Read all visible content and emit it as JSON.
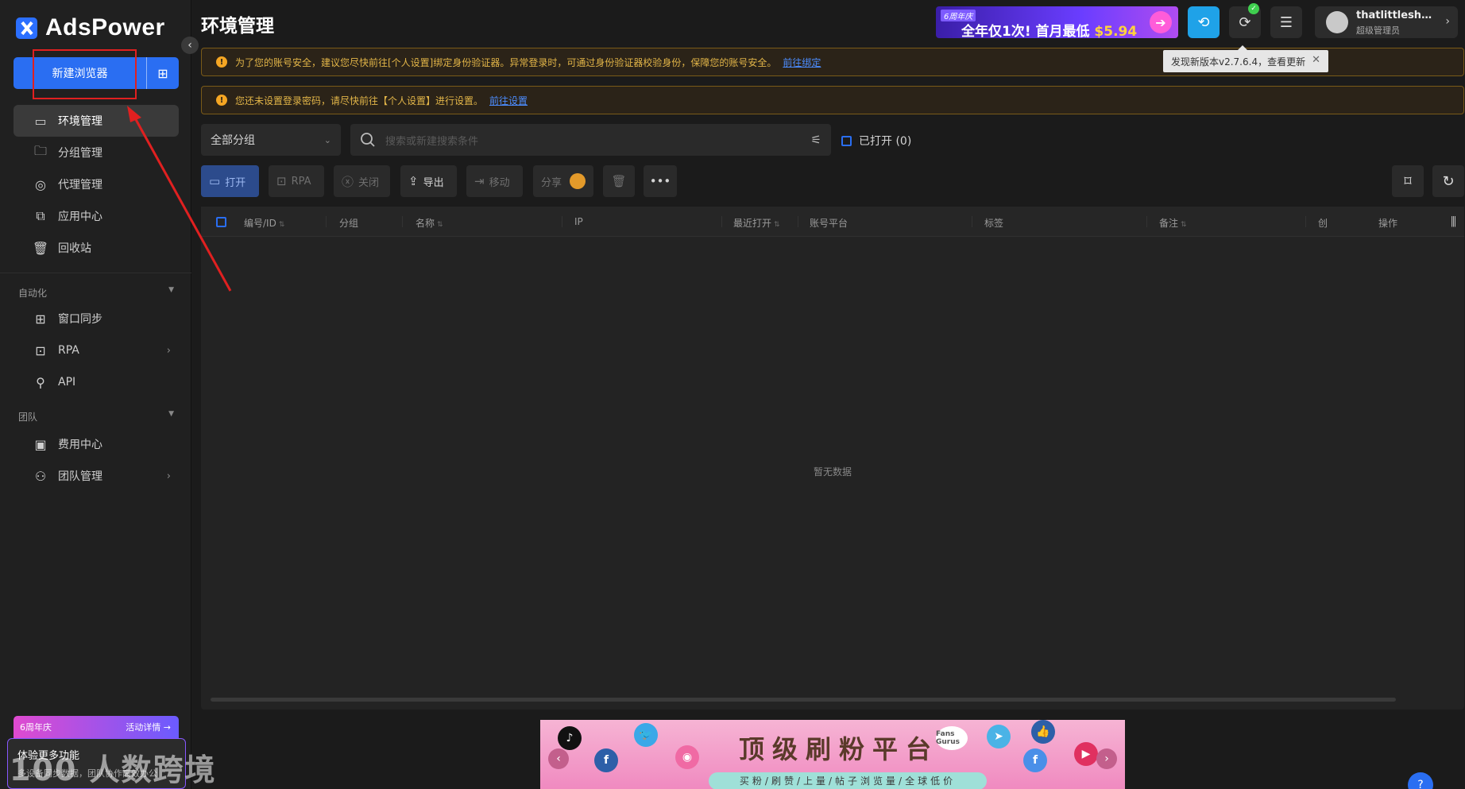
{
  "app": {
    "name": "AdsPower"
  },
  "sidebar": {
    "new_browser_label": "新建浏览器",
    "items": [
      {
        "label": "环境管理",
        "icon": "browser-window-icon",
        "glyph": "▭"
      },
      {
        "label": "分组管理",
        "icon": "folder-icon",
        "glyph": "🗀"
      },
      {
        "label": "代理管理",
        "icon": "proxy-icon",
        "glyph": "◎"
      },
      {
        "label": "应用中心",
        "icon": "puzzle-icon",
        "glyph": "⧉"
      },
      {
        "label": "回收站",
        "icon": "trash-icon",
        "glyph": "🗑"
      }
    ],
    "sections": [
      {
        "label": "自动化",
        "items": [
          {
            "label": "窗口同步",
            "icon": "sync-windows-icon",
            "glyph": "⊞"
          },
          {
            "label": "RPA",
            "icon": "robot-icon",
            "glyph": "⊡"
          },
          {
            "label": "API",
            "icon": "plug-icon",
            "glyph": "⚲"
          }
        ]
      },
      {
        "label": "团队",
        "items": [
          {
            "label": "费用中心",
            "icon": "billing-icon",
            "glyph": "▣"
          },
          {
            "label": "团队管理",
            "icon": "team-icon",
            "glyph": "⚇"
          }
        ]
      }
    ],
    "promo": {
      "tag": "6周年庆",
      "link": "活动详情 →",
      "title": "体验更多功能",
      "desc": "多设备同步数据，团队协作高效办公"
    },
    "watermark": "100 人数跨境"
  },
  "header": {
    "title": "环境管理",
    "ad": {
      "tag": "6周年庆",
      "text": "全年仅1次! 首月最低 ",
      "price": "$5.94"
    },
    "user": {
      "name": "thatlittlesheep...",
      "role": "超级管理员"
    },
    "tooltip": "发现新版本v2.7.6.4，查看更新"
  },
  "alerts": [
    {
      "text": "为了您的账号安全，建议您尽快前往[个人设置]绑定身份验证器。异常登录时，可通过身份验证器校验身份，保障您的账号安全。",
      "link": "前往绑定"
    },
    {
      "text": "您还未设置登录密码，请尽快前往【个人设置】进行设置。",
      "link": "前往设置"
    }
  ],
  "filters": {
    "group": "全部分组",
    "search_placeholder": "搜索或新建搜索条件",
    "opened_label": "已打开 (0)"
  },
  "toolbar": {
    "open": "打开",
    "rpa": "RPA",
    "close": "关闭",
    "export": "导出",
    "move": "移动",
    "share": "分享"
  },
  "table": {
    "columns": [
      "编号/ID",
      "分组",
      "名称",
      "IP",
      "最近打开",
      "账号平台",
      "标签",
      "备注",
      "创",
      "操作"
    ],
    "empty_text": "暂无数据"
  },
  "bottom_ad": {
    "headline": "顶级刷粉平台",
    "brand": "Fans Gurus",
    "sub": "买粉/刷赞/上量/帖子浏览量/全球低价"
  }
}
